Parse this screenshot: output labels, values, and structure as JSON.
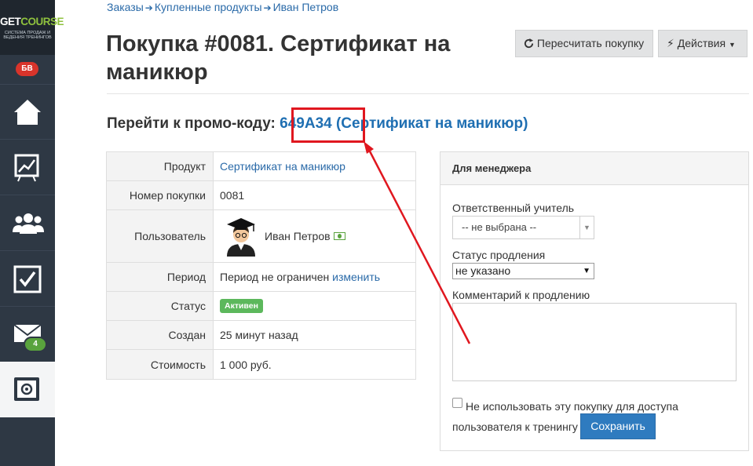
{
  "sidebar": {
    "logo_text_1": "GET",
    "logo_text_2": "COURSE",
    "logo_subtitle": "СИСТЕМА ПРОДАЖ И ВЕДЕНИЯ ТРЕНИНГОВ",
    "badge": "БВ",
    "mail_count": "4",
    "items": [
      {
        "icon": "home-icon"
      },
      {
        "icon": "chart-icon"
      },
      {
        "icon": "users-icon"
      },
      {
        "icon": "checkbox-icon"
      },
      {
        "icon": "mail-icon"
      },
      {
        "icon": "safe-icon"
      }
    ]
  },
  "breadcrumb": {
    "items": [
      "Заказы",
      "Купленные продукты",
      "Иван Петров"
    ],
    "separator": "➔"
  },
  "page": {
    "title": "Покупка #0081. Сертификат на маникюр",
    "recalc_button": "Пересчитать покупку",
    "actions_button": "Действия"
  },
  "promo": {
    "label": "Перейти к промо-коду:",
    "code": "649A34",
    "name": "(Сертификат на маникюр)"
  },
  "info": {
    "rows": [
      {
        "label": "Продукт",
        "value": "Сертификат на маникюр"
      },
      {
        "label": "Номер покупки",
        "value": "0081"
      },
      {
        "label": "Пользователь",
        "value": "Иван Петров"
      },
      {
        "label": "Период",
        "value": "Период не ограничен",
        "link": "изменить"
      },
      {
        "label": "Статус",
        "value": "Активен"
      },
      {
        "label": "Создан",
        "value": "25 минут назад"
      },
      {
        "label": "Стоимость",
        "value": "1 000 руб."
      }
    ]
  },
  "manager": {
    "title": "Для менеджера",
    "teacher_label": "Ответственный учитель",
    "teacher_value": "-- не выбрана --",
    "renewal_label": "Статус продления",
    "renewal_value": "не указано",
    "comment_label": "Комментарий к продлению",
    "checkbox_label": "Не использовать эту покупку для доступа пользователя к тренингу",
    "save_button": "Сохранить"
  },
  "colors": {
    "sidebar_bg": "#2e3844",
    "link": "#2a6aa8",
    "highlight": "#e0171f",
    "status_active": "#5cb85c",
    "primary_button": "#2f7bbf"
  }
}
